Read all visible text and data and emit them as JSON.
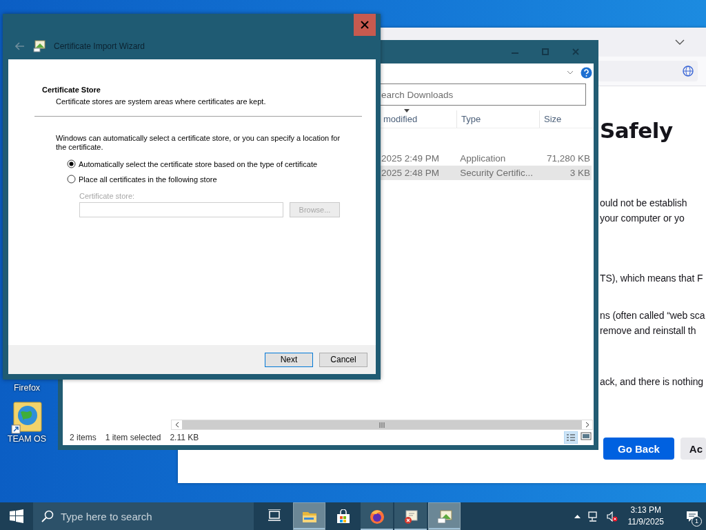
{
  "wizard": {
    "title": "Certificate Import Wizard",
    "heading": "Certificate Store",
    "subtitle": "Certificate stores are system areas where certificates are kept.",
    "intro": "Windows can automatically select a certificate store, or you can specify a location for the certificate.",
    "options": [
      {
        "label": "Automatically select the certificate store based on the type of certificate",
        "selected": true
      },
      {
        "label": "Place all certificates in the following store",
        "selected": false
      }
    ],
    "store_field": {
      "label": "Certificate store:",
      "disabled": true
    },
    "browse_button": {
      "label": "Browse...",
      "disabled": true
    },
    "buttons": [
      "Next",
      "Cancel"
    ]
  },
  "explorer": {
    "search": {
      "placeholder": "earch Downloads"
    },
    "columns": [
      "modified",
      "Type",
      "Size"
    ],
    "rows": [
      {
        "date": "2025 2:49 PM",
        "type": "Application",
        "size": "71,280 KB",
        "selected": false
      },
      {
        "date": "2025 2:48 PM",
        "type": "Security Certific...",
        "size": "3 KB",
        "selected": true
      }
    ],
    "status_bar": [
      "2 items",
      "1 item selected",
      "2.11 KB"
    ]
  },
  "browser": {
    "heading": "Safely",
    "paragraphs": [
      [
        "ould not be establish",
        "your computer or yo"
      ],
      [
        "TS), which means that F"
      ],
      [
        "ns (often called “web sca",
        " remove and reinstall th"
      ],
      [
        "ack, and there is nothing"
      ]
    ],
    "buttons": [
      {
        "label": "Go Back",
        "kind": "primary"
      },
      {
        "label": "Ac",
        "kind": "secondary"
      }
    ]
  },
  "desktop_icons": [
    {
      "label": "Firefox",
      "kind": "hidden"
    },
    {
      "label": "TEAM OS",
      "kind": "globe"
    }
  ],
  "taskbar": {
    "search": {
      "placeholder": "Type here to search"
    },
    "apps": [
      {
        "kind": "task-view",
        "running": false,
        "highlighted": false
      },
      {
        "kind": "explorer",
        "running": true,
        "highlighted": true
      },
      {
        "kind": "store",
        "running": false,
        "highlighted": false
      },
      {
        "kind": "firefox",
        "running": true,
        "highlighted": false
      },
      {
        "kind": "cert-error",
        "running": true,
        "highlighted": false
      },
      {
        "kind": "cert",
        "running": true,
        "highlighted": true
      }
    ],
    "clock": {
      "time": "3:13 PM",
      "date": "11/9/2025"
    },
    "notifications": "1"
  }
}
